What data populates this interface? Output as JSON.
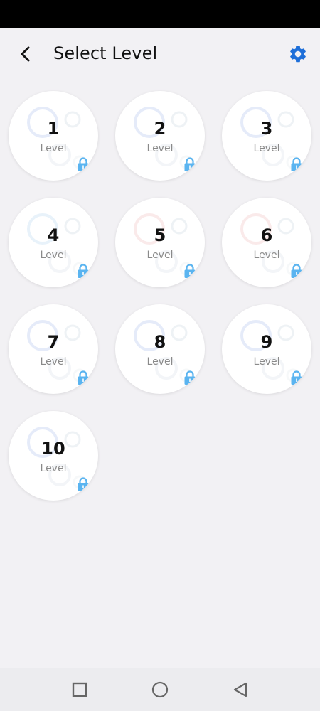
{
  "app_bar": {
    "title": "Select Level",
    "back_icon": "chevron-left-icon",
    "settings_icon": "gear-icon"
  },
  "levels": [
    {
      "number": "1",
      "caption": "Level",
      "locked": true,
      "accent": "#6f8fe0"
    },
    {
      "number": "2",
      "caption": "Level",
      "locked": true,
      "accent": "#6f8fe0"
    },
    {
      "number": "3",
      "caption": "Level",
      "locked": true,
      "accent": "#6f8fe0"
    },
    {
      "number": "4",
      "caption": "Level",
      "locked": true,
      "accent": "#7fb6e6"
    },
    {
      "number": "5",
      "caption": "Level",
      "locked": true,
      "accent": "#e28a8a"
    },
    {
      "number": "6",
      "caption": "Level",
      "locked": true,
      "accent": "#e28a8a"
    },
    {
      "number": "7",
      "caption": "Level",
      "locked": true,
      "accent": "#6f8fe0"
    },
    {
      "number": "8",
      "caption": "Level",
      "locked": true,
      "accent": "#6f8fe0"
    },
    {
      "number": "9",
      "caption": "Level",
      "locked": true,
      "accent": "#6f8fe0"
    },
    {
      "number": "10",
      "caption": "Level",
      "locked": true,
      "accent": "#6f8fe0"
    }
  ],
  "nav_bar": {
    "recents_icon": "square-icon",
    "home_icon": "circle-icon",
    "back_icon": "triangle-back-icon"
  },
  "colors": {
    "accent": "#1e6fd9",
    "lock": "#5ab4f0",
    "background": "#f2f1f4"
  }
}
